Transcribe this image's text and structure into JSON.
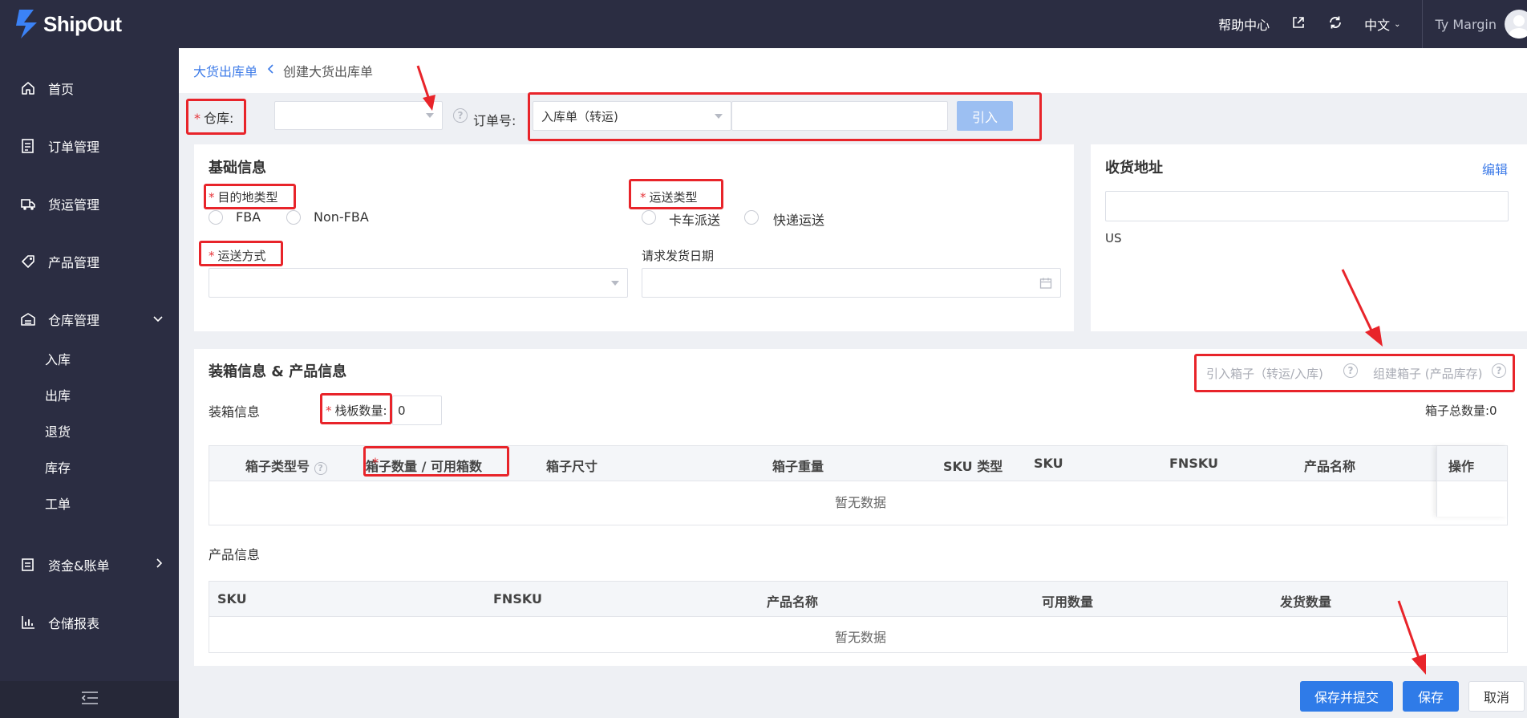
{
  "app": {
    "logo_text": "ShipOut"
  },
  "topbar": {
    "help_center": "帮助中心",
    "language": "中文",
    "user_name": "Ty Margin"
  },
  "sidebar": {
    "items": [
      {
        "label": "首页",
        "icon": "home-icon"
      },
      {
        "label": "订单管理",
        "icon": "order-icon"
      },
      {
        "label": "货运管理",
        "icon": "truck-icon"
      },
      {
        "label": "产品管理",
        "icon": "tag-icon"
      },
      {
        "label": "仓库管理",
        "icon": "warehouse-icon",
        "expanded": true
      },
      {
        "label": "资金&账单",
        "icon": "wallet-icon"
      },
      {
        "label": "仓储报表",
        "icon": "chart-icon"
      }
    ],
    "warehouse_sub": [
      "入库",
      "出库",
      "退货",
      "库存",
      "工单"
    ]
  },
  "breadcrumb": {
    "parent": "大货出库单",
    "current": "创建大货出库单"
  },
  "order_row": {
    "warehouse_label": "仓库:",
    "order_no_label": "订单号:",
    "order_type_value": "入库单（转运)",
    "import_button": "引入"
  },
  "basic_info": {
    "title": "基础信息",
    "dest_type_label": "目的地类型",
    "dest_options": [
      "FBA",
      "Non-FBA"
    ],
    "ship_type_label": "运送类型",
    "ship_type_options": [
      "卡车派送",
      "快递运送"
    ],
    "ship_method_label": "运送方式",
    "request_date_label": "请求发货日期"
  },
  "address": {
    "title": "收货地址",
    "edit_link": "编辑",
    "country": "US"
  },
  "packing": {
    "title": "装箱信息 & 产品信息",
    "import_box_link": "引入箱子（转运/入库)",
    "build_box_link": "组建箱子 (产品库存)",
    "packing_label": "装箱信息",
    "pallet_label": "栈板数量:",
    "pallet_value": "0",
    "box_total": "箱子总数量:0",
    "box_table": {
      "headers": [
        "箱子类型号",
        "箱子数量 / 可用箱数",
        "箱子尺寸",
        "箱子重量",
        "SKU 类型",
        "SKU",
        "FNSKU",
        "产品名称",
        "操作"
      ],
      "empty_text": "暂无数据"
    },
    "product_label": "产品信息",
    "product_table": {
      "headers": [
        "SKU",
        "FNSKU",
        "产品名称",
        "可用数量",
        "发货数量"
      ],
      "empty_text": "暂无数据"
    }
  },
  "footer": {
    "save_submit": "保存并提交",
    "save": "保存",
    "cancel": "取消"
  },
  "colors": {
    "sidebar_bg": "#2b2d42",
    "primary": "#2f7be8",
    "annotation_red": "#e8242a"
  }
}
